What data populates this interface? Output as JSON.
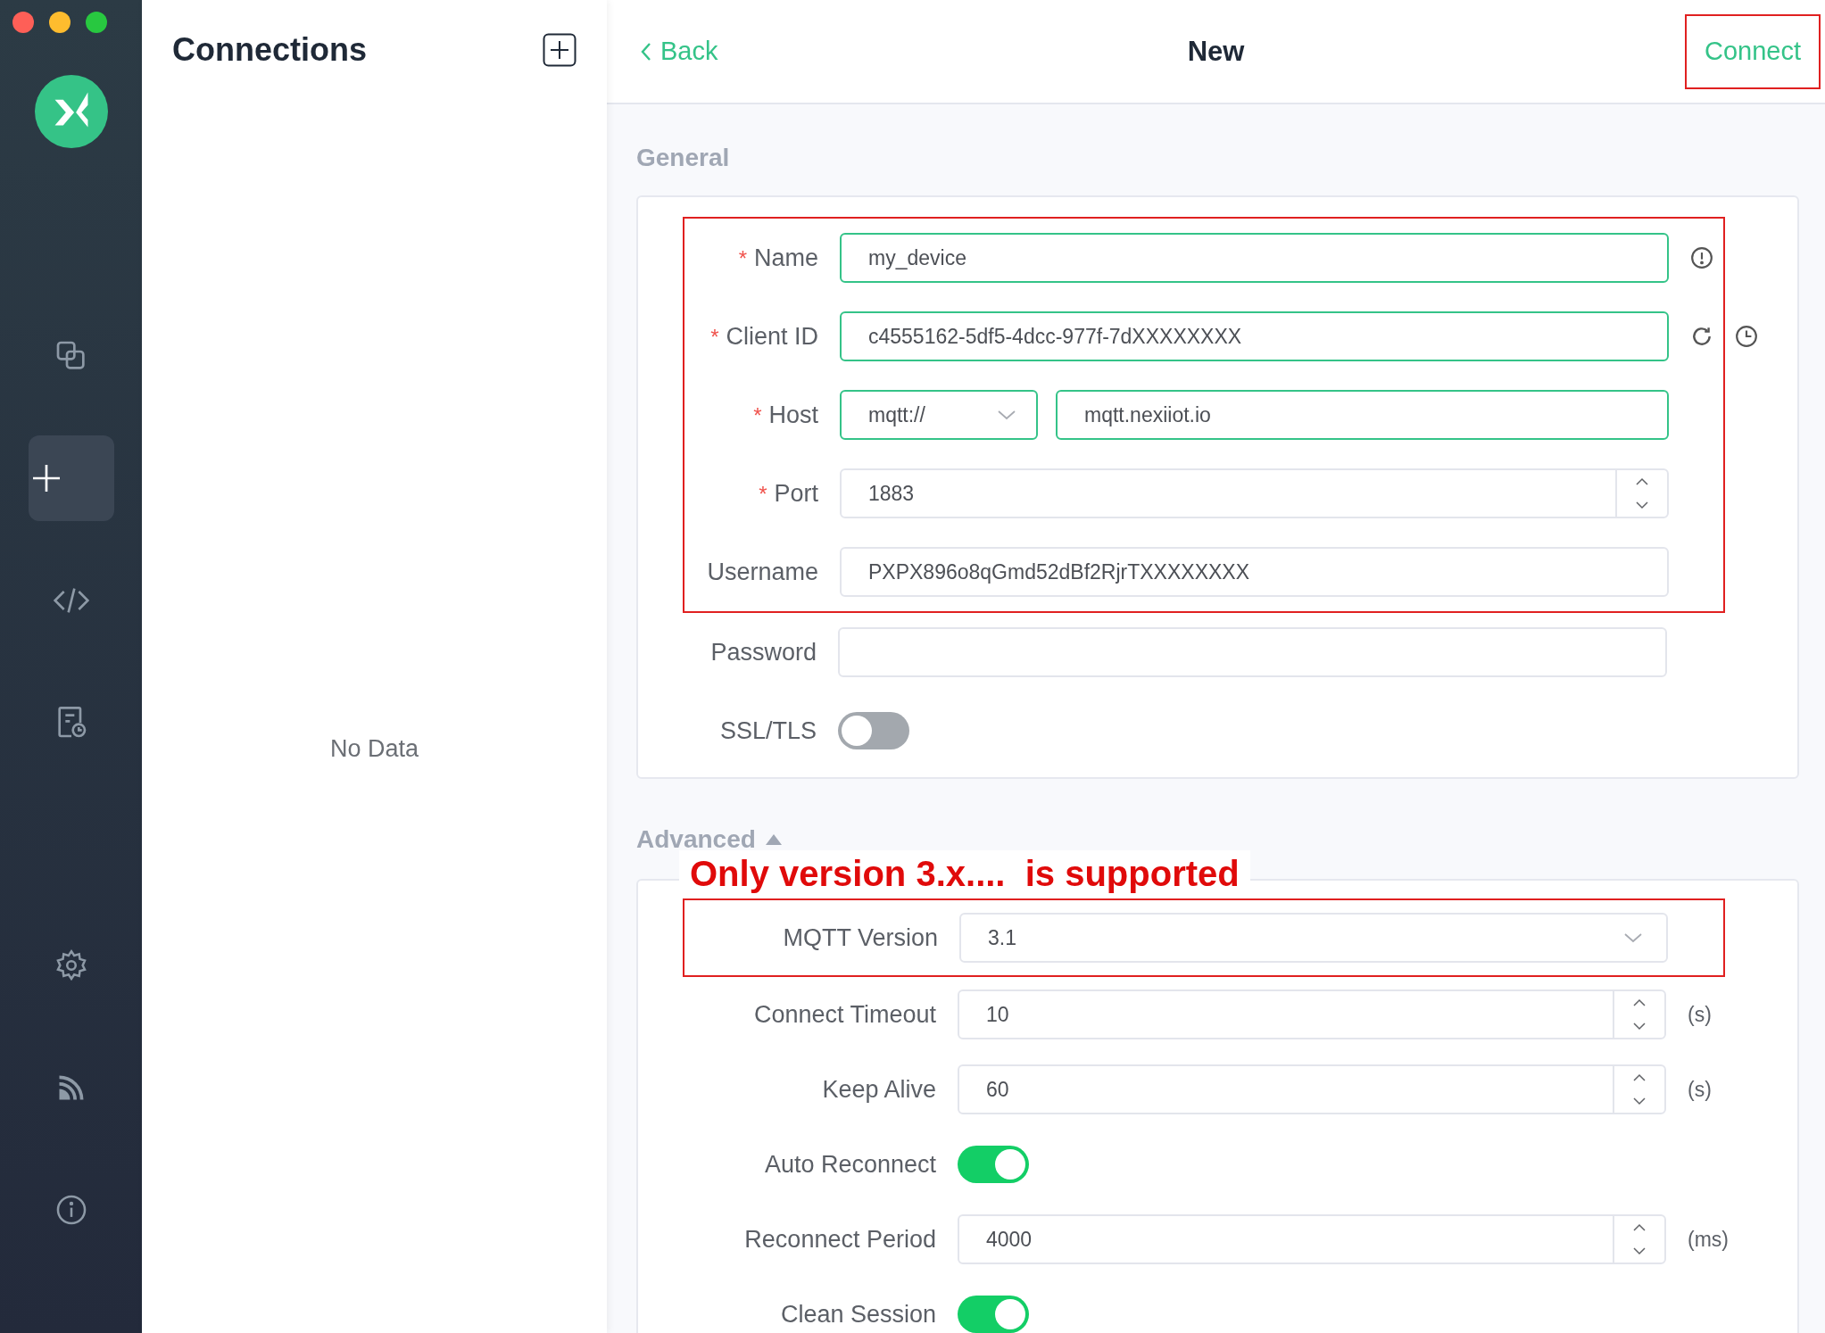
{
  "sidebar": {
    "nav_top": [
      {
        "kind": "connections",
        "selected": false
      },
      {
        "kind": "new",
        "selected": true
      },
      {
        "kind": "script",
        "selected": false
      },
      {
        "kind": "log",
        "selected": false
      }
    ],
    "nav_bottom": [
      {
        "kind": "settings",
        "selected": false
      },
      {
        "kind": "feed",
        "selected": false
      },
      {
        "kind": "about",
        "selected": false
      }
    ]
  },
  "connections_panel": {
    "title": "Connections",
    "empty_text": "No Data"
  },
  "header": {
    "back": "Back",
    "title": "New",
    "connect": {
      "label": "Connect",
      "highlighted": true
    }
  },
  "general": {
    "title": "General",
    "fields": [
      {
        "kind": "text",
        "label": "Name",
        "required_mark": "*",
        "value": "my_device",
        "valid": true,
        "highlighted": true,
        "actions": [
          {
            "kind": "info"
          }
        ]
      },
      {
        "kind": "text",
        "label": "Client ID",
        "required_mark": "*",
        "value": "c4555162-5df5-4dcc-977f-7dXXXXXXXX",
        "valid": true,
        "highlighted": true,
        "actions": [
          {
            "kind": "refresh"
          },
          {
            "kind": "clock"
          }
        ]
      },
      {
        "kind": "host",
        "label": "Host",
        "required_mark": "*",
        "protocol": "mqtt://",
        "value": "mqtt.nexiiot.io",
        "valid": true,
        "highlighted": true
      },
      {
        "kind": "number",
        "label": "Port",
        "required_mark": "*",
        "value": "1883",
        "valid": false,
        "highlighted": true
      },
      {
        "kind": "text",
        "label": "Username",
        "value": "PXPX896o8qGmd52dBf2RjrTXXXXXXXX",
        "valid": false,
        "highlighted": true
      },
      {
        "kind": "text",
        "label": "Password",
        "valid": false,
        "highlighted": false
      },
      {
        "kind": "switch",
        "label": "SSL/TLS",
        "on": false,
        "highlighted": false
      }
    ]
  },
  "advanced": {
    "title": "Advanced",
    "expanded": true,
    "note": "Only version 3.x....  is supported",
    "fields": [
      {
        "kind": "select",
        "label": "MQTT Version",
        "value": "3.1",
        "highlighted": true
      },
      {
        "kind": "number",
        "label": "Connect Timeout",
        "value": "10",
        "unit": "(s)",
        "highlighted": false
      },
      {
        "kind": "number",
        "label": "Keep Alive",
        "value": "60",
        "unit": "(s)",
        "highlighted": false
      },
      {
        "kind": "switch",
        "label": "Auto Reconnect",
        "on": true,
        "highlighted": false
      },
      {
        "kind": "number",
        "label": "Reconnect Period",
        "value": "4000",
        "unit": "(ms)",
        "highlighted": false
      },
      {
        "kind": "switch",
        "label": "Clean Session",
        "on": true,
        "highlighted": false
      }
    ]
  }
}
